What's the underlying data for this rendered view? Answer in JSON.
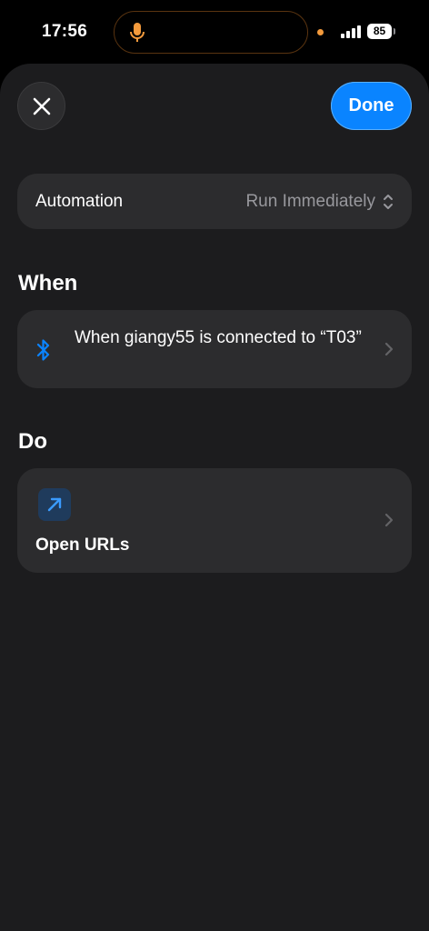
{
  "status_bar": {
    "time": "17:56",
    "battery": "85",
    "indicator_color": "#f39a3c"
  },
  "header": {
    "close_icon": "close-icon",
    "done_label": "Done"
  },
  "automation": {
    "label": "Automation",
    "value": "Run Immediately"
  },
  "when": {
    "title": "When",
    "trigger_text": "When giangy55 is connected to “T03”",
    "icon": "bluetooth-icon"
  },
  "do": {
    "title": "Do",
    "action_label": "Open URLs",
    "icon": "arrow-up-right-icon"
  },
  "colors": {
    "accent": "#0a84ff",
    "sheet_bg": "#1c1c1e",
    "card_bg": "#2c2c2e",
    "secondary_text": "#98989d"
  }
}
